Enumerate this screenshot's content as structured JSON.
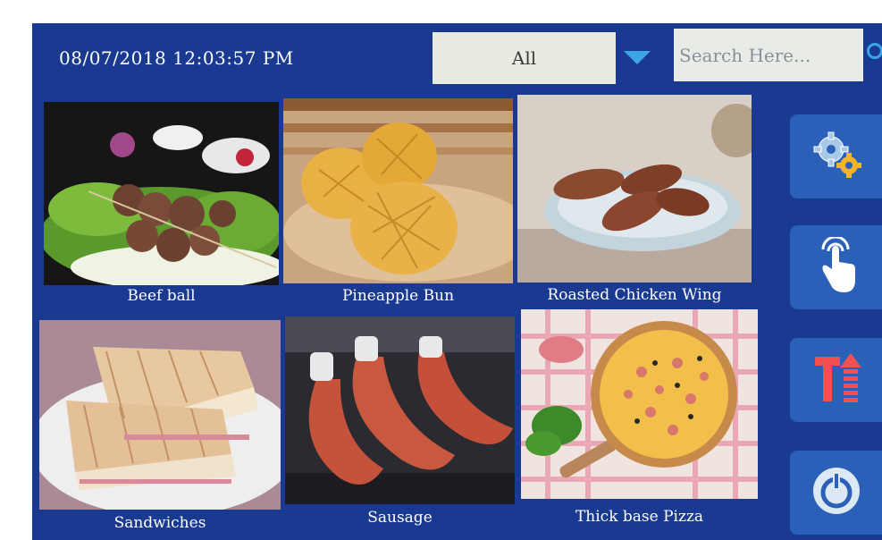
{
  "header": {
    "datetime": "08/07/2018 12:03:57 PM",
    "category_selected": "All",
    "search_placeholder": "Search Here..."
  },
  "menu_items": [
    {
      "label": "Beef ball"
    },
    {
      "label": "Pineapple Bun"
    },
    {
      "label": "Roasted Chicken Wing"
    },
    {
      "label": "Sandwiches"
    },
    {
      "label": "Sausage"
    },
    {
      "label": "Thick base Pizza"
    }
  ],
  "sidebar": [
    {
      "icon": "gears-icon"
    },
    {
      "icon": "touch-hand-icon"
    },
    {
      "icon": "text-size-icon"
    },
    {
      "icon": "power-icon"
    }
  ],
  "colors": {
    "background": "#1a3a92",
    "accent": "#3aa6e6",
    "sidebar_button": "#2a60b8"
  }
}
